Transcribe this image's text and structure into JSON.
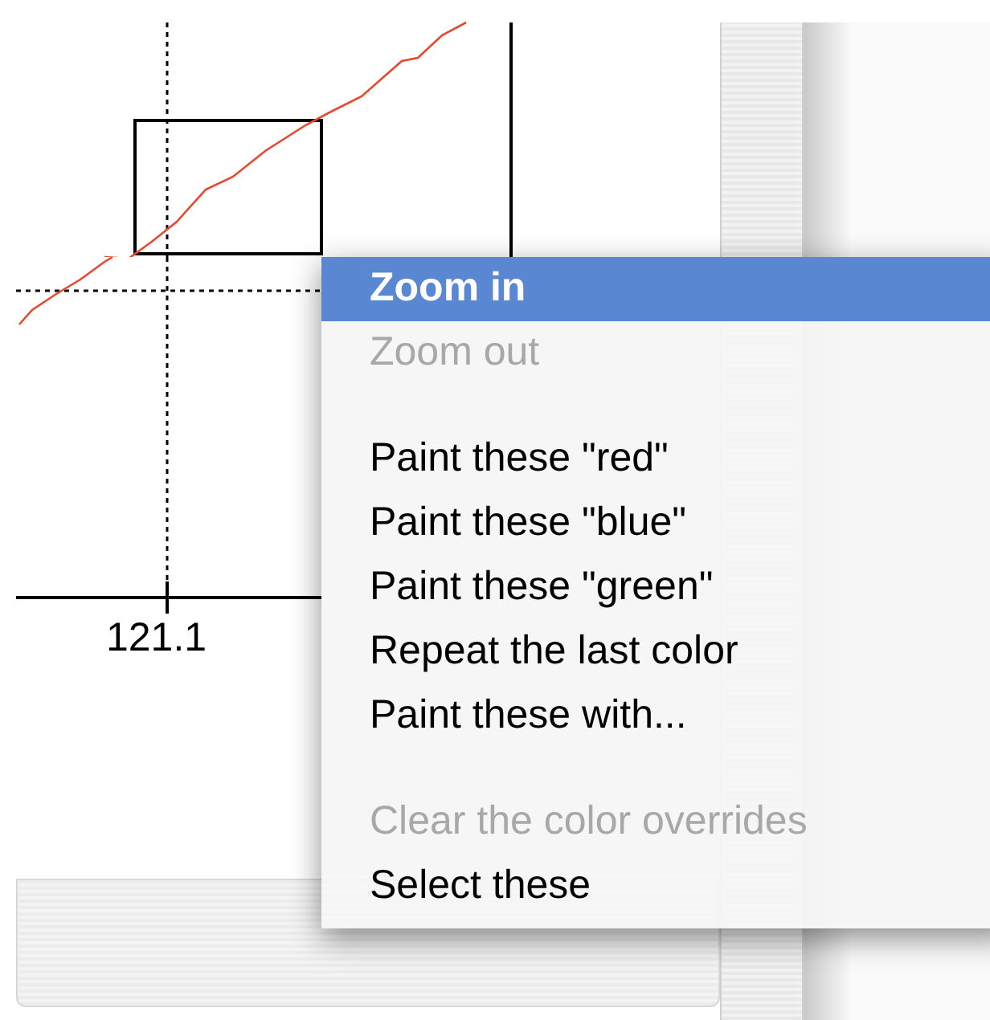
{
  "plot": {
    "x_tick_label": "121.1"
  },
  "context_menu": {
    "items": [
      {
        "kind": "item",
        "label": "Zoom in",
        "selected": true,
        "disabled": false
      },
      {
        "kind": "item",
        "label": "Zoom out",
        "selected": false,
        "disabled": true
      },
      {
        "kind": "separator"
      },
      {
        "kind": "item",
        "label": "Paint these \"red\"",
        "selected": false,
        "disabled": false
      },
      {
        "kind": "item",
        "label": "Paint these \"blue\"",
        "selected": false,
        "disabled": false
      },
      {
        "kind": "item",
        "label": "Paint these \"green\"",
        "selected": false,
        "disabled": false
      },
      {
        "kind": "item",
        "label": "Repeat the last color",
        "selected": false,
        "disabled": false
      },
      {
        "kind": "item",
        "label": "Paint these with...",
        "selected": false,
        "disabled": false
      },
      {
        "kind": "separator"
      },
      {
        "kind": "item",
        "label": "Clear the color overrides",
        "selected": false,
        "disabled": true
      },
      {
        "kind": "item",
        "label": "Select these",
        "selected": false,
        "disabled": false
      }
    ]
  }
}
